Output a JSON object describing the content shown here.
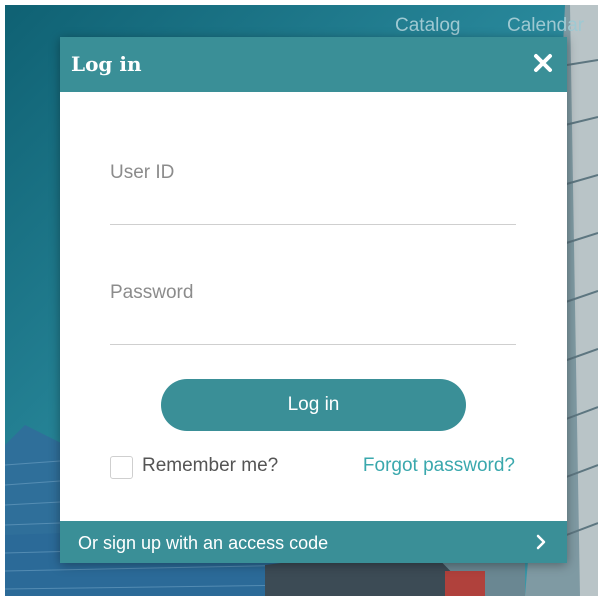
{
  "top_nav": {
    "catalog": "Catalog",
    "calendar": "Calendar"
  },
  "modal": {
    "title": "Log in",
    "close_icon": "close-icon",
    "user_id": {
      "placeholder": "User ID",
      "value": ""
    },
    "password": {
      "placeholder": "Password",
      "value": ""
    },
    "login_button": "Log in",
    "remember_me": {
      "label": "Remember me?",
      "checked": false
    },
    "forgot_password": "Forgot password?",
    "signup": {
      "label": "Or sign up with an access code",
      "icon": "chevron-right-icon"
    }
  },
  "colors": {
    "accent": "#3a8f97",
    "link": "#3aa8ad",
    "background": "#1f7487"
  }
}
